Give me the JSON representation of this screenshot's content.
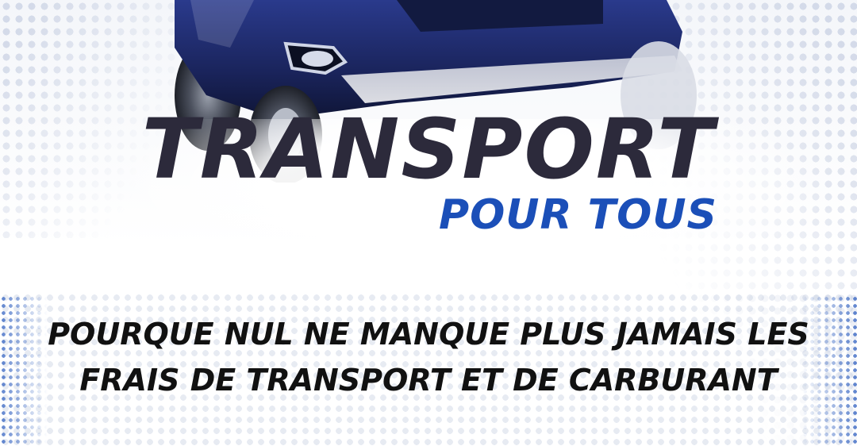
{
  "banner": {
    "title": "TRANSPORT",
    "subtitle": "POUR TOUS",
    "tagline_line1": "POURQUE NUL NE MANQUE PLUS JAMAIS LES",
    "tagline_line2": "FRAIS DE TRANSPORT ET DE CARBURANT"
  },
  "colors": {
    "title": "#2c2a3b",
    "subtitle": "#1b4fb8",
    "tagline": "#111111",
    "car_body": "#1f2d6e",
    "dots_accent": "#285abe"
  },
  "images": {
    "hero": "blue-suv-car-photo"
  }
}
